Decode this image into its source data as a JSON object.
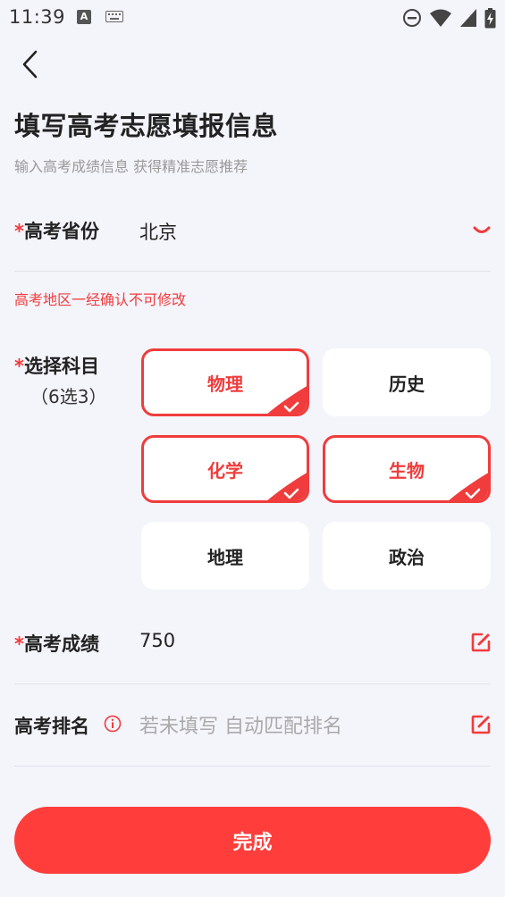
{
  "status_bar": {
    "time": "11:39",
    "left_icons": [
      "text-input-indicator-icon",
      "keyboard-icon"
    ],
    "right_icons": [
      "do-not-disturb-icon",
      "wifi-icon",
      "cellular-signal-icon",
      "battery-charging-icon"
    ],
    "indicator_letter": "A"
  },
  "header": {
    "back_icon": "chevron-left-icon",
    "title": "填写高考志愿填报信息",
    "subtitle": "输入高考成绩信息 获得精准志愿推荐"
  },
  "province": {
    "required_mark": "*",
    "label": "高考省份",
    "value": "北京",
    "dropdown_icon": "chevron-down-icon",
    "warning": "高考地区一经确认不可修改"
  },
  "subjects": {
    "required_mark": "*",
    "label": "选择科目",
    "sub_label": "（6选3）",
    "items": [
      {
        "label": "物理",
        "selected": true
      },
      {
        "label": "历史",
        "selected": false
      },
      {
        "label": "化学",
        "selected": true
      },
      {
        "label": "生物",
        "selected": true
      },
      {
        "label": "地理",
        "selected": false
      },
      {
        "label": "政治",
        "selected": false
      }
    ]
  },
  "score": {
    "required_mark": "*",
    "label": "高考成绩",
    "value": "750",
    "edit_icon": "edit-icon"
  },
  "rank": {
    "label": "高考排名",
    "info_icon": "info-icon",
    "placeholder": "若未填写 自动匹配排名",
    "edit_icon": "edit-icon"
  },
  "done_button": {
    "label": "完成"
  },
  "colors": {
    "accent": "#f03c3c",
    "button": "#ff3e3c",
    "background": "#f4f4fb"
  }
}
